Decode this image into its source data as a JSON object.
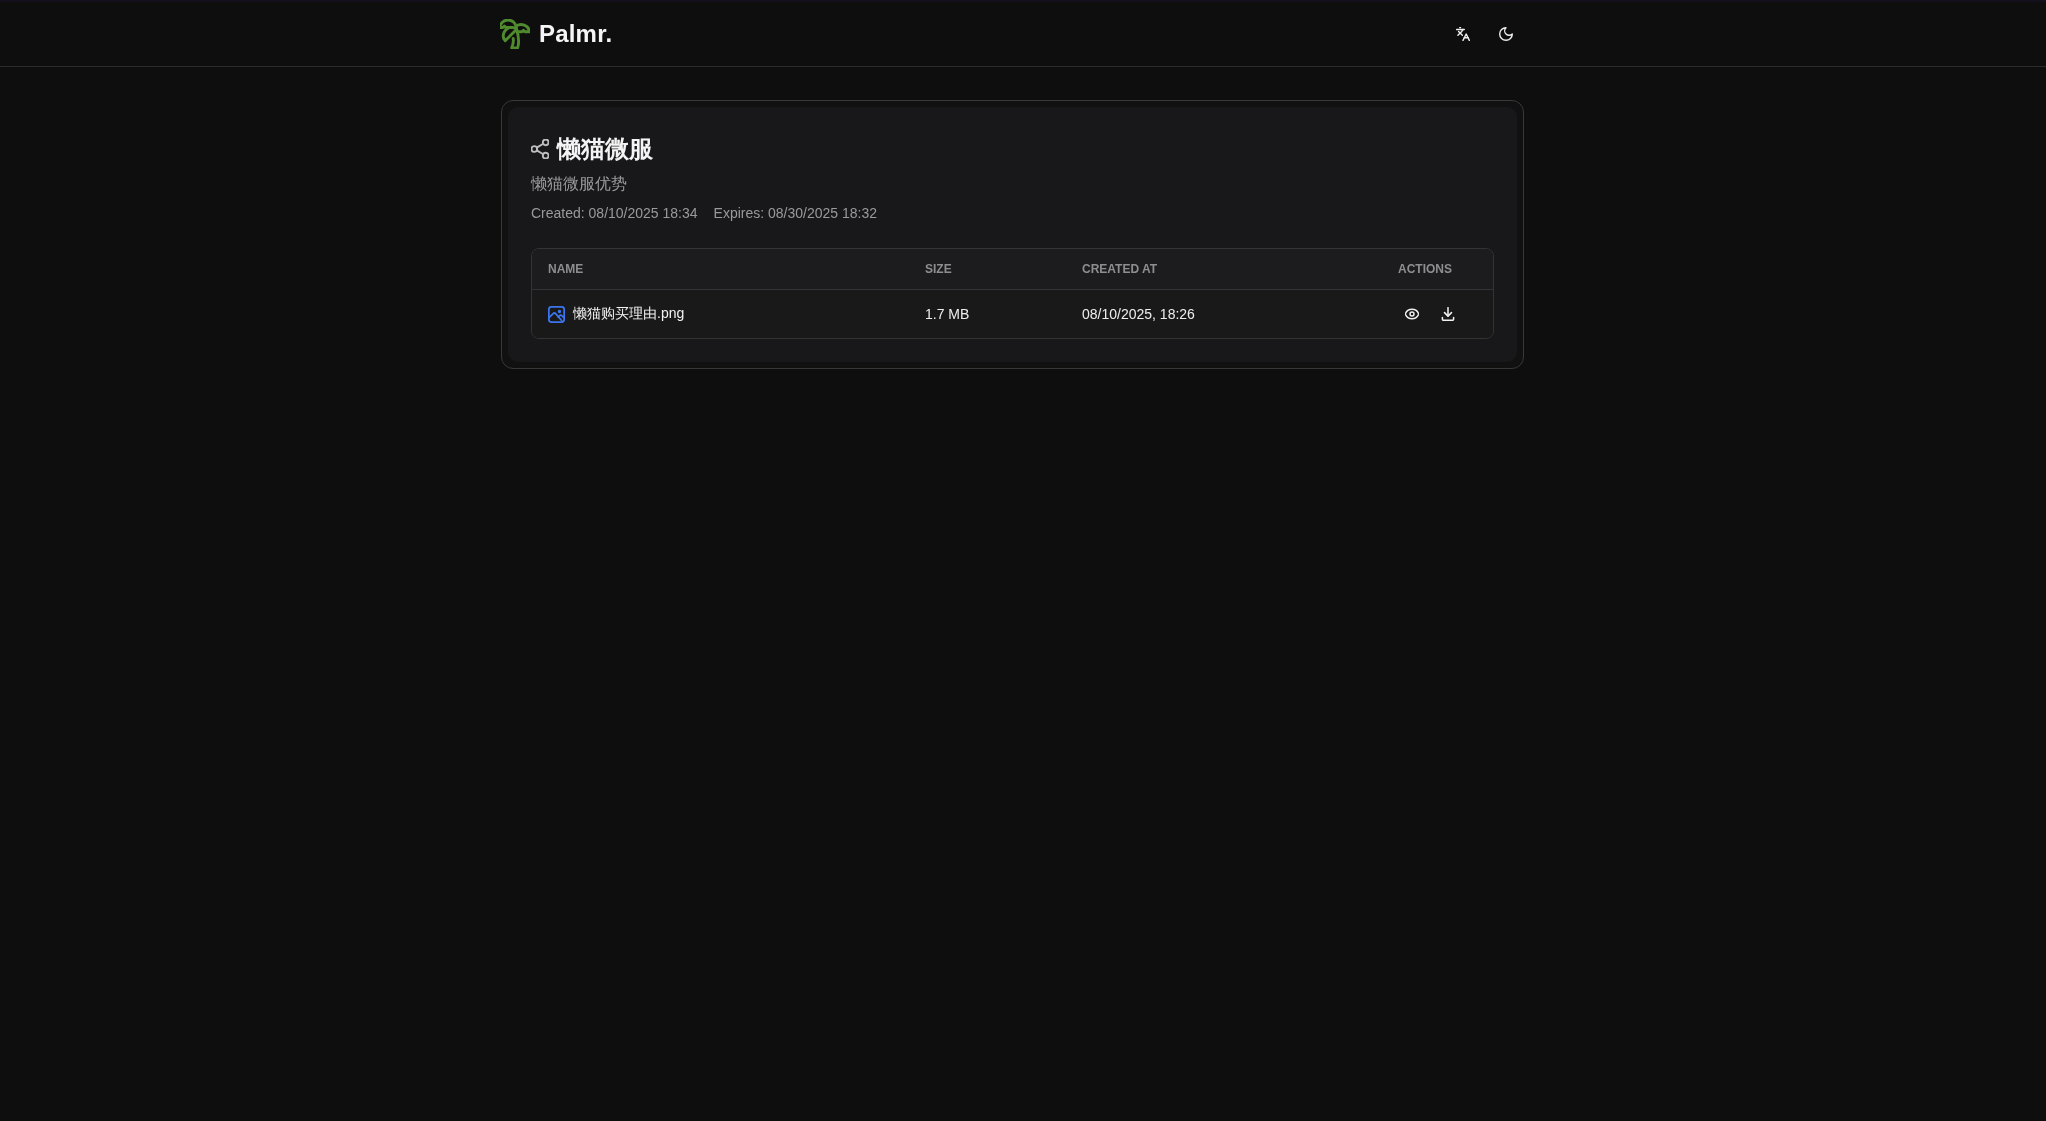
{
  "header": {
    "brand": "Palmr."
  },
  "share": {
    "title": "懒猫微服",
    "description": "懒猫微服优势",
    "created": "Created: 08/10/2025 18:34",
    "expires": "Expires: 08/30/2025 18:32"
  },
  "files_table": {
    "columns": [
      "NAME",
      "SIZE",
      "CREATED AT",
      "ACTIONS"
    ],
    "rows": [
      {
        "kind": "image",
        "name": "懒猫购买理由.png",
        "size": "1.7 MB",
        "created_at": "08/10/2025, 18:26"
      }
    ]
  }
}
